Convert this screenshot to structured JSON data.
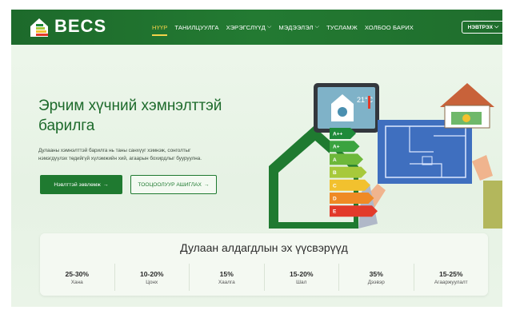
{
  "brand": {
    "name": "BECS"
  },
  "nav": {
    "items": [
      {
        "label": "НҮҮР",
        "active": true,
        "has_dropdown": false
      },
      {
        "label": "ТАНИЛЦУУЛГА",
        "active": false,
        "has_dropdown": false
      },
      {
        "label": "ХЭРЭГСЛҮҮД",
        "active": false,
        "has_dropdown": true
      },
      {
        "label": "МЭДЭЭЛЭЛ",
        "active": false,
        "has_dropdown": true
      },
      {
        "label": "ТУСЛАМЖ",
        "active": false,
        "has_dropdown": false
      },
      {
        "label": "ХОЛБОО БАРИХ",
        "active": false,
        "has_dropdown": false
      }
    ],
    "login_label": "НЭВТРЭХ"
  },
  "hero": {
    "title_line1": "Эрчим хүчний хэмнэлттэй",
    "title_line2": "барилга",
    "description_line1": "Дулааны хэмнэлттэй барилга нь таны санхүүг хэмнэж, сонголтыг",
    "description_line2": "нэмэгдүүлэх төдийгүй хүлэмжийн хий, агаарын бохирдлыг бууруулна.",
    "primary_button": "Нэвлттэй зөвлөмж",
    "secondary_button": "ТООЦООЛУУР АШИГЛАХ",
    "arrow": "→"
  },
  "illustration": {
    "thermostat": "21°C",
    "energy_classes": [
      "A++",
      "A+",
      "A",
      "B",
      "C",
      "D",
      "E"
    ],
    "energy_colors": [
      "#1e8a3a",
      "#3aa33f",
      "#6db83a",
      "#a7c93b",
      "#f2c12e",
      "#ef8a25",
      "#e23a2a"
    ]
  },
  "heat_loss": {
    "title": "Дулаан алдагдлын эх үүсвэрүүд",
    "items": [
      {
        "value": "25-30%",
        "label": "Хана"
      },
      {
        "value": "10-20%",
        "label": "Цонх"
      },
      {
        "value": "15%",
        "label": "Хаалга"
      },
      {
        "value": "15-20%",
        "label": "Шал"
      },
      {
        "value": "35%",
        "label": "Дээвэр"
      },
      {
        "value": "15-25%",
        "label": "Агааржуулалт"
      }
    ]
  },
  "colors": {
    "primary": "#1f7a30",
    "accent": "#f3d24a",
    "background": "#eaf4e8"
  }
}
